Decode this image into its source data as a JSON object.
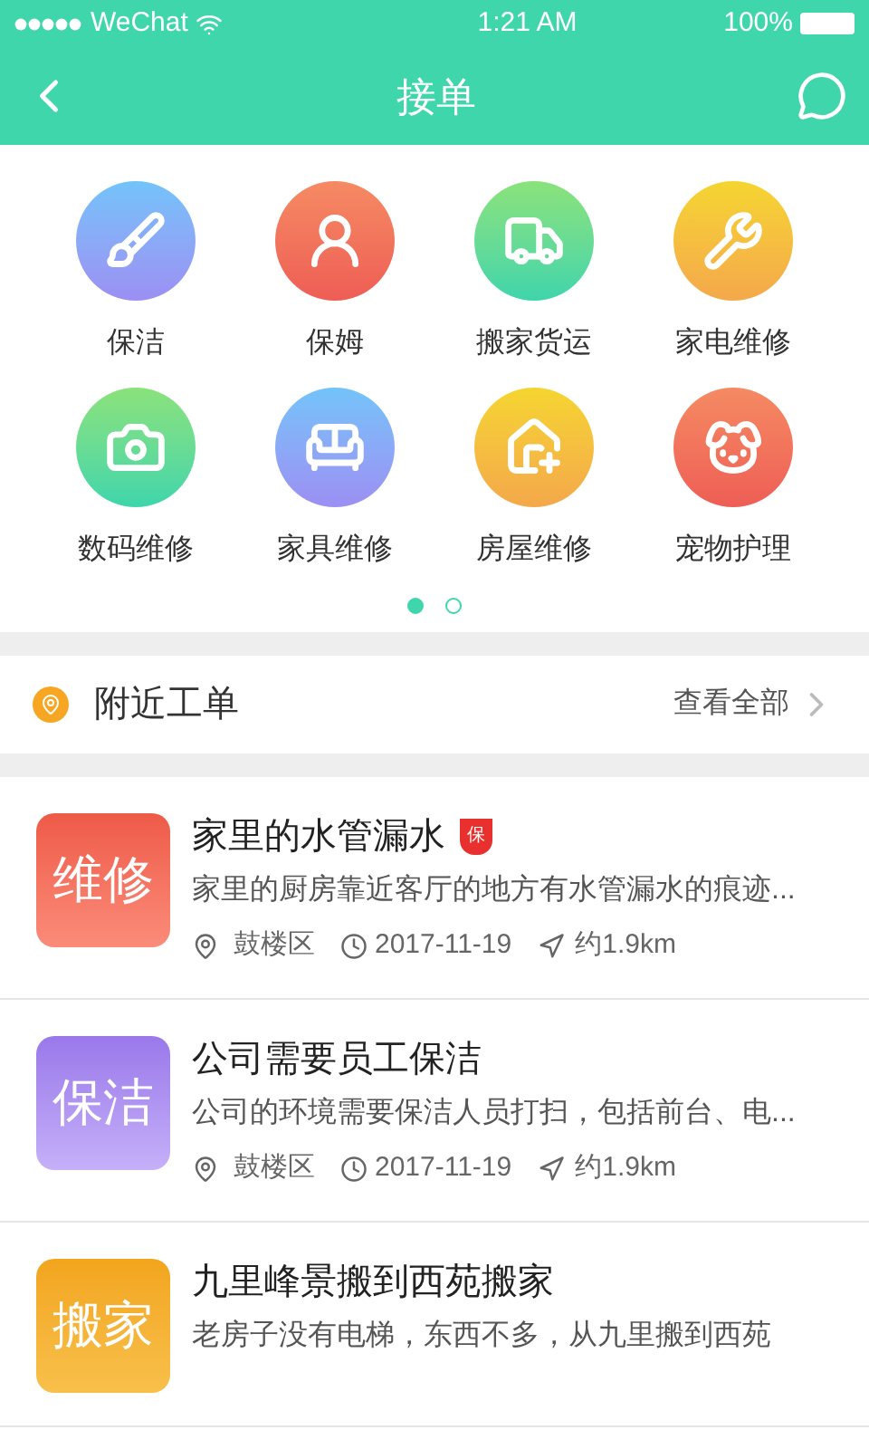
{
  "status_bar": {
    "carrier": "WeChat",
    "time": "1:21 AM",
    "battery": "100%"
  },
  "nav": {
    "title": "接单"
  },
  "categories": [
    {
      "label": "保洁"
    },
    {
      "label": "保姆"
    },
    {
      "label": "搬家货运"
    },
    {
      "label": "家电维修"
    },
    {
      "label": "数码维修"
    },
    {
      "label": "家具维修"
    },
    {
      "label": "房屋维修"
    },
    {
      "label": "宠物护理"
    }
  ],
  "pager": [
    {
      "selected": true
    },
    {
      "selected": false
    }
  ],
  "nearby": {
    "title": "附近工单",
    "link": "查看全部"
  },
  "orders": [
    {
      "tag": "维修",
      "title": "家里的水管漏水",
      "badge": "保",
      "desc": "家里的厨房靠近客厅的地方有水管漏水的痕迹...",
      "district": "鼓楼区",
      "date": "2017-11-19",
      "distance": "约1.9km"
    },
    {
      "tag": "保洁",
      "title": "公司需要员工保洁",
      "desc": "公司的环境需要保洁人员打扫，包括前台、电...",
      "district": "鼓楼区",
      "date": "2017-11-19",
      "distance": "约1.9km"
    },
    {
      "tag": "搬家",
      "title": "九里峰景搬到西苑搬家",
      "desc": "老房子没有电梯，东西不多，从九里搬到西苑"
    }
  ]
}
